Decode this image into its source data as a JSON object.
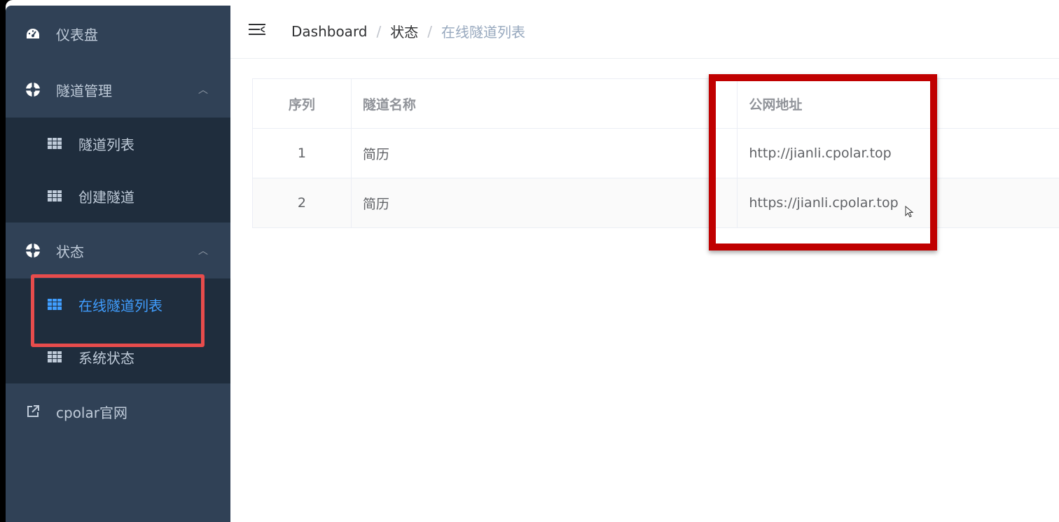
{
  "sidebar": {
    "items": [
      {
        "label": "仪表盘",
        "icon": "dashboard-icon"
      },
      {
        "label": "隧道管理",
        "icon": "lifebuoy-icon",
        "children": [
          {
            "label": "隧道列表",
            "icon": "table-icon"
          },
          {
            "label": "创建隧道",
            "icon": "table-icon"
          }
        ]
      },
      {
        "label": "状态",
        "icon": "lifebuoy-icon",
        "children": [
          {
            "label": "在线隧道列表",
            "icon": "table-icon",
            "active": true
          },
          {
            "label": "系统状态",
            "icon": "table-icon"
          }
        ]
      },
      {
        "label": "cpolar官网",
        "icon": "external-link-icon"
      }
    ]
  },
  "header": {
    "breadcrumb": [
      "Dashboard",
      "状态",
      "在线隧道列表"
    ],
    "separator": "/"
  },
  "table": {
    "columns": [
      "序列",
      "隧道名称",
      "公网地址"
    ],
    "rows": [
      {
        "index": "1",
        "name": "简历",
        "url": "http://jianli.cpolar.top"
      },
      {
        "index": "2",
        "name": "简历",
        "url": "https://jianli.cpolar.top"
      }
    ]
  },
  "colors": {
    "sidebar_bg": "#304156",
    "submenu_bg": "#1f2d3d",
    "active": "#409eff",
    "annotation_red": "#c00000",
    "annotation_pink": "#e84c4c"
  }
}
